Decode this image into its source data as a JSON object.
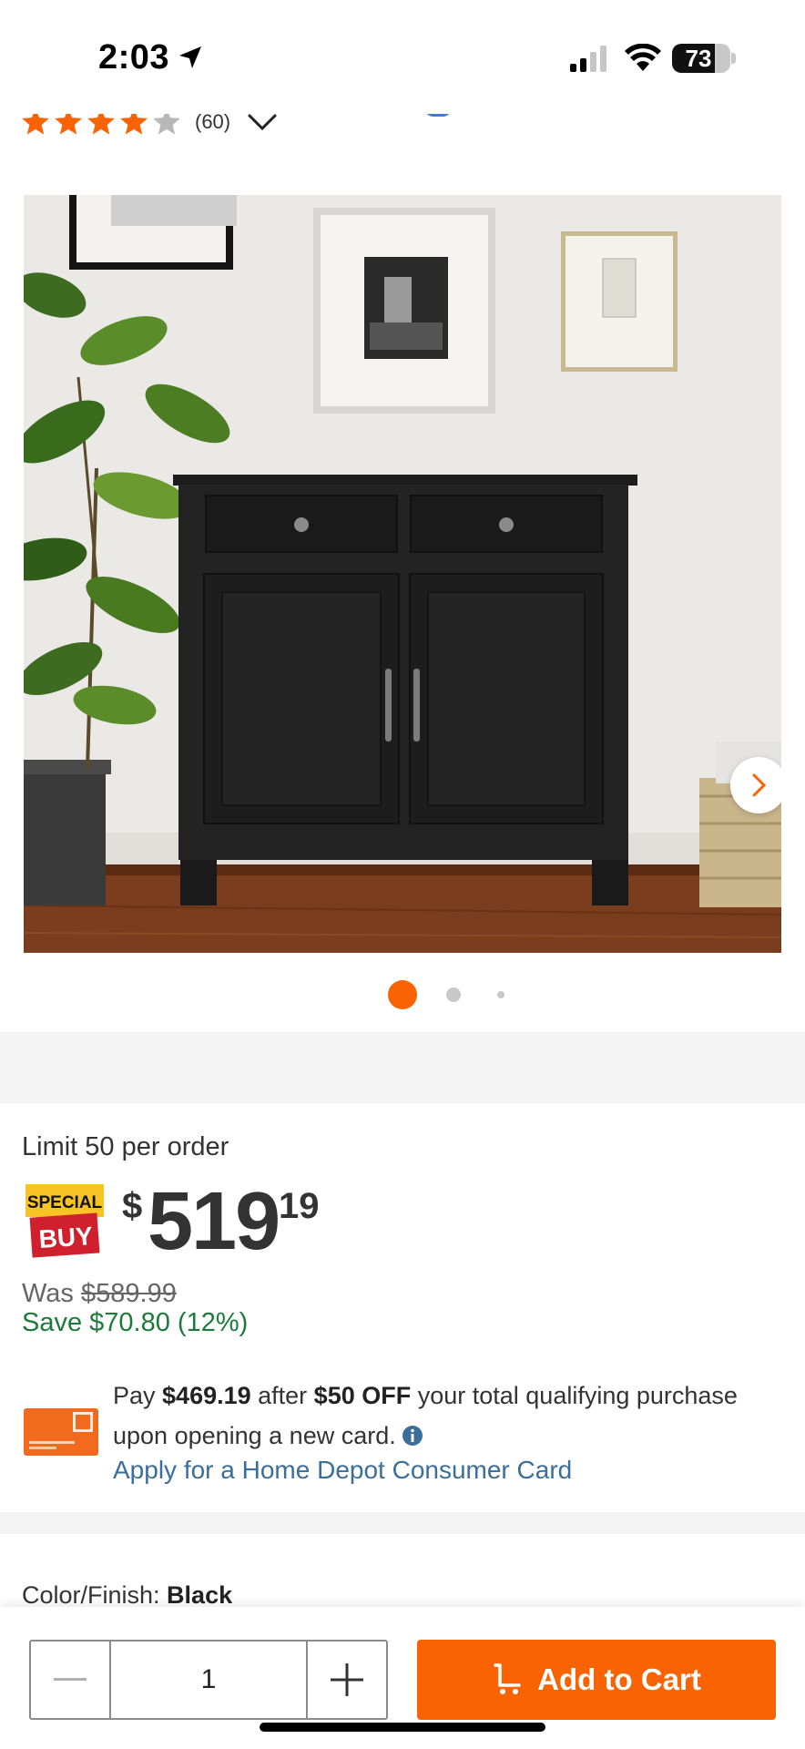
{
  "status_bar": {
    "time": "2:03",
    "battery": "73",
    "battery_level": 0.73
  },
  "rating": {
    "stars": 4,
    "max_stars": 5,
    "count": "(60)"
  },
  "gallery": {
    "current_index": 0,
    "dot_count": 3,
    "active_color": "#F96302",
    "inactive_color": "#C8C8C8"
  },
  "pricing": {
    "limit": "Limit 50 per order",
    "badge_top": "SPECIAL",
    "badge_bottom": "BUY",
    "currency": "$",
    "dollars": "519",
    "cents": "19",
    "was_label": "Was",
    "was_price": "$589.99",
    "save": "Save $70.80 (12%)"
  },
  "promo": {
    "t1": "Pay ",
    "amount": "$469.19",
    "t2": " after ",
    "discount": "$50 OFF",
    "t3": " your total qualifying purchase upon opening a new card.",
    "link": "Apply for a Home Depot Consumer Card"
  },
  "color_finish": {
    "label": "Color/Finish: ",
    "value": "Black"
  },
  "cart": {
    "quantity": "1",
    "button": "Add to Cart"
  },
  "colors": {
    "brand_orange": "#F96302",
    "save_green": "#1D7A3A",
    "link_blue": "#3B6E9A"
  },
  "icons": [
    "location-arrow-icon",
    "signal-icon",
    "wifi-icon",
    "star-icon",
    "chevron-down-icon",
    "chevron-right-icon",
    "info-icon",
    "minus-icon",
    "plus-icon",
    "cart-icon"
  ]
}
